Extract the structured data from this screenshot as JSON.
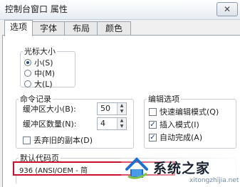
{
  "window": {
    "title": "控制台窗口 属性",
    "close_glyph": "✕"
  },
  "tabs": [
    {
      "label": "选项",
      "active": true
    },
    {
      "label": "字体"
    },
    {
      "label": "布局"
    },
    {
      "label": "颜色"
    }
  ],
  "cursor_size": {
    "legend": "光标大小",
    "options": [
      {
        "label": "小(S)",
        "selected": true
      },
      {
        "label": "中(M)",
        "selected": false
      },
      {
        "label": "大(L)",
        "selected": false
      }
    ]
  },
  "command_history": {
    "legend": "命令记录",
    "buffer_size": {
      "label": "缓冲区大小(B):",
      "value": "50"
    },
    "buffer_count": {
      "label": "缓冲区数量(N):",
      "value": "4"
    },
    "discard_duplicates": {
      "label": "丢弃旧的副本(D)",
      "checked": false
    }
  },
  "edit_options": {
    "legend": "编辑选项",
    "quick_edit": {
      "label": "快速编辑模式(Q)",
      "checked": false
    },
    "insert_mode": {
      "label": "插入模式(I)",
      "checked": true
    },
    "auto_complete": {
      "label": "自动完成(A)",
      "checked": true
    }
  },
  "default_codepage": {
    "legend": "默认代码页",
    "value": "936   (ANSI/OEM - 简"
  },
  "watermark": {
    "text": "系统之家",
    "url": "xitongzhijia.net"
  },
  "colors": {
    "highlight_border": "#c8102e",
    "accent": "#1e4d8c"
  }
}
